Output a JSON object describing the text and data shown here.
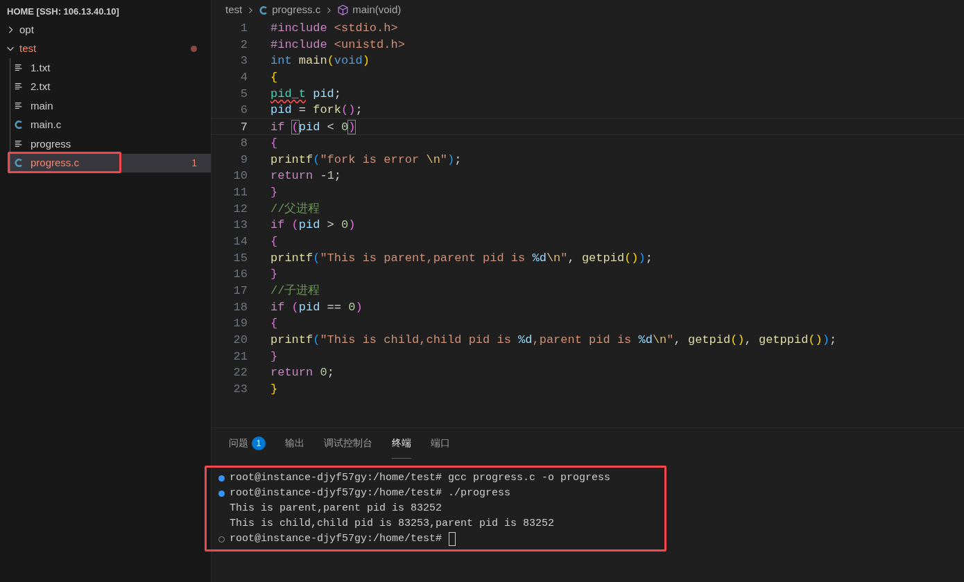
{
  "explorer": {
    "title": "HOME [SSH: 106.13.40.10]",
    "items": [
      {
        "label": "opt",
        "kind": "folder",
        "expanded": false,
        "error": false
      },
      {
        "label": "test",
        "kind": "folder",
        "expanded": true,
        "error": true,
        "children": [
          {
            "label": "1.txt",
            "kind": "text",
            "selected": false,
            "error": false
          },
          {
            "label": "2.txt",
            "kind": "text",
            "selected": false,
            "error": false
          },
          {
            "label": "main",
            "kind": "text",
            "selected": false,
            "error": false
          },
          {
            "label": "main.c",
            "kind": "c",
            "selected": false,
            "error": false
          },
          {
            "label": "progress",
            "kind": "text",
            "selected": false,
            "error": false
          },
          {
            "label": "progress.c",
            "kind": "c",
            "selected": true,
            "error": true,
            "badge": "1",
            "highlighted": true
          }
        ]
      }
    ]
  },
  "breadcrumb": [
    {
      "label": "test",
      "kind": "folder"
    },
    {
      "label": "progress.c",
      "kind": "c"
    },
    {
      "label": "main(void)",
      "kind": "symbol"
    }
  ],
  "editor": {
    "lines": [
      {
        "number": "1",
        "current": false,
        "tokens": [
          {
            "text": "#include ",
            "kind": "control"
          },
          {
            "text": "<stdio.h>",
            "kind": "string"
          }
        ]
      },
      {
        "number": "2",
        "current": false,
        "tokens": [
          {
            "text": "#include ",
            "kind": "control"
          },
          {
            "text": "<unistd.h>",
            "kind": "string"
          }
        ]
      },
      {
        "number": "3",
        "current": false,
        "tokens": [
          {
            "text": "int ",
            "kind": "keyword"
          },
          {
            "text": "main",
            "kind": "function"
          },
          {
            "text": "(",
            "kind": "bracket1"
          },
          {
            "text": "void",
            "kind": "keyword"
          },
          {
            "text": ")",
            "kind": "bracket1"
          }
        ]
      },
      {
        "number": "4",
        "current": false,
        "tokens": [
          {
            "text": "{",
            "kind": "bracket1"
          }
        ]
      },
      {
        "number": "5",
        "current": false,
        "tokens": [
          {
            "text": "pid_t",
            "kind": "type_error"
          },
          {
            "text": " pid",
            "kind": "variable"
          },
          {
            "text": ";",
            "kind": "plain"
          }
        ]
      },
      {
        "number": "6",
        "current": false,
        "tokens": [
          {
            "text": "pid",
            "kind": "variable"
          },
          {
            "text": " = ",
            "kind": "plain"
          },
          {
            "text": "fork",
            "kind": "function"
          },
          {
            "text": "(",
            "kind": "bracket2"
          },
          {
            "text": ")",
            "kind": "bracket2"
          },
          {
            "text": ";",
            "kind": "plain"
          }
        ]
      },
      {
        "number": "7",
        "current": true,
        "tokens": [
          {
            "text": "if ",
            "kind": "control"
          },
          {
            "text": "(",
            "kind": "bracket2_matched"
          },
          {
            "text": "pid",
            "kind": "variable"
          },
          {
            "text": " < ",
            "kind": "plain"
          },
          {
            "text": "0",
            "kind": "number"
          },
          {
            "text": ")",
            "kind": "bracket2_matched"
          }
        ]
      },
      {
        "number": "8",
        "current": false,
        "tokens": [
          {
            "text": "{",
            "kind": "bracket2"
          }
        ]
      },
      {
        "number": "9",
        "current": false,
        "tokens": [
          {
            "text": "printf",
            "kind": "function"
          },
          {
            "text": "(",
            "kind": "bracket3"
          },
          {
            "text": "\"fork is error ",
            "kind": "string"
          },
          {
            "text": "\\n",
            "kind": "escape"
          },
          {
            "text": "\"",
            "kind": "string"
          },
          {
            "text": ")",
            "kind": "bracket3"
          },
          {
            "text": ";",
            "kind": "plain"
          }
        ]
      },
      {
        "number": "10",
        "current": false,
        "tokens": [
          {
            "text": "return ",
            "kind": "control"
          },
          {
            "text": "-",
            "kind": "plain"
          },
          {
            "text": "1",
            "kind": "number"
          },
          {
            "text": ";",
            "kind": "plain"
          }
        ]
      },
      {
        "number": "11",
        "current": false,
        "tokens": [
          {
            "text": "}",
            "kind": "bracket2"
          }
        ]
      },
      {
        "number": "12",
        "current": false,
        "tokens": [
          {
            "text": "//父进程",
            "kind": "comment"
          }
        ]
      },
      {
        "number": "13",
        "current": false,
        "tokens": [
          {
            "text": "if ",
            "kind": "control"
          },
          {
            "text": "(",
            "kind": "bracket2"
          },
          {
            "text": "pid",
            "kind": "variable"
          },
          {
            "text": " > ",
            "kind": "plain"
          },
          {
            "text": "0",
            "kind": "number"
          },
          {
            "text": ")",
            "kind": "bracket2"
          }
        ]
      },
      {
        "number": "14",
        "current": false,
        "tokens": [
          {
            "text": "{",
            "kind": "bracket2"
          }
        ]
      },
      {
        "number": "15",
        "current": false,
        "tokens": [
          {
            "text": "printf",
            "kind": "function"
          },
          {
            "text": "(",
            "kind": "bracket3"
          },
          {
            "text": "\"This is parent,parent pid is ",
            "kind": "string"
          },
          {
            "text": "%d",
            "kind": "format"
          },
          {
            "text": "\\n",
            "kind": "escape"
          },
          {
            "text": "\"",
            "kind": "string"
          },
          {
            "text": ", ",
            "kind": "plain"
          },
          {
            "text": "getpid",
            "kind": "function"
          },
          {
            "text": "(",
            "kind": "bracket1"
          },
          {
            "text": ")",
            "kind": "bracket1"
          },
          {
            "text": ")",
            "kind": "bracket3"
          },
          {
            "text": ";",
            "kind": "plain"
          }
        ]
      },
      {
        "number": "16",
        "current": false,
        "tokens": [
          {
            "text": "}",
            "kind": "bracket2"
          }
        ]
      },
      {
        "number": "17",
        "current": false,
        "tokens": [
          {
            "text": "//子进程",
            "kind": "comment"
          }
        ]
      },
      {
        "number": "18",
        "current": false,
        "tokens": [
          {
            "text": "if ",
            "kind": "control"
          },
          {
            "text": "(",
            "kind": "bracket2"
          },
          {
            "text": "pid",
            "kind": "variable"
          },
          {
            "text": " == ",
            "kind": "plain"
          },
          {
            "text": "0",
            "kind": "number"
          },
          {
            "text": ")",
            "kind": "bracket2"
          }
        ]
      },
      {
        "number": "19",
        "current": false,
        "tokens": [
          {
            "text": "{",
            "kind": "bracket2"
          }
        ]
      },
      {
        "number": "20",
        "current": false,
        "tokens": [
          {
            "text": "printf",
            "kind": "function"
          },
          {
            "text": "(",
            "kind": "bracket3"
          },
          {
            "text": "\"This is child,child pid is ",
            "kind": "string"
          },
          {
            "text": "%d",
            "kind": "format"
          },
          {
            "text": ",parent pid is ",
            "kind": "string"
          },
          {
            "text": "%d",
            "kind": "format"
          },
          {
            "text": "\\n",
            "kind": "escape"
          },
          {
            "text": "\"",
            "kind": "string"
          },
          {
            "text": ", ",
            "kind": "plain"
          },
          {
            "text": "getpid",
            "kind": "function"
          },
          {
            "text": "(",
            "kind": "bracket1"
          },
          {
            "text": ")",
            "kind": "bracket1"
          },
          {
            "text": ", ",
            "kind": "plain"
          },
          {
            "text": "getppid",
            "kind": "function"
          },
          {
            "text": "(",
            "kind": "bracket1"
          },
          {
            "text": ")",
            "kind": "bracket1"
          },
          {
            "text": ")",
            "kind": "bracket3"
          },
          {
            "text": ";",
            "kind": "plain"
          }
        ]
      },
      {
        "number": "21",
        "current": false,
        "tokens": [
          {
            "text": "}",
            "kind": "bracket2"
          }
        ]
      },
      {
        "number": "22",
        "current": false,
        "tokens": [
          {
            "text": "return ",
            "kind": "control"
          },
          {
            "text": "0",
            "kind": "number"
          },
          {
            "text": ";",
            "kind": "plain"
          }
        ]
      },
      {
        "number": "23",
        "current": false,
        "tokens": [
          {
            "text": "}",
            "kind": "bracket1"
          }
        ]
      }
    ]
  },
  "panel": {
    "tabs": [
      {
        "label": "问题",
        "badge": "1",
        "selected": false
      },
      {
        "label": "输出",
        "selected": false
      },
      {
        "label": "调试控制台",
        "selected": false
      },
      {
        "label": "终端",
        "selected": true
      },
      {
        "label": "端口",
        "selected": false
      }
    ],
    "terminal": {
      "highlighted": true,
      "lines": [
        {
          "kind": "command",
          "done": true,
          "text": "root@instance-djyf57gy:/home/test# gcc progress.c -o progress"
        },
        {
          "kind": "command",
          "done": true,
          "text": "root@instance-djyf57gy:/home/test# ./progress"
        },
        {
          "kind": "output",
          "text": "This is parent,parent pid is 83252"
        },
        {
          "kind": "output",
          "text": "This is child,child pid is 83253,parent pid is 83252"
        },
        {
          "kind": "command",
          "done": false,
          "cursor": true,
          "text": "root@instance-djyf57gy:/home/test#"
        }
      ]
    }
  }
}
